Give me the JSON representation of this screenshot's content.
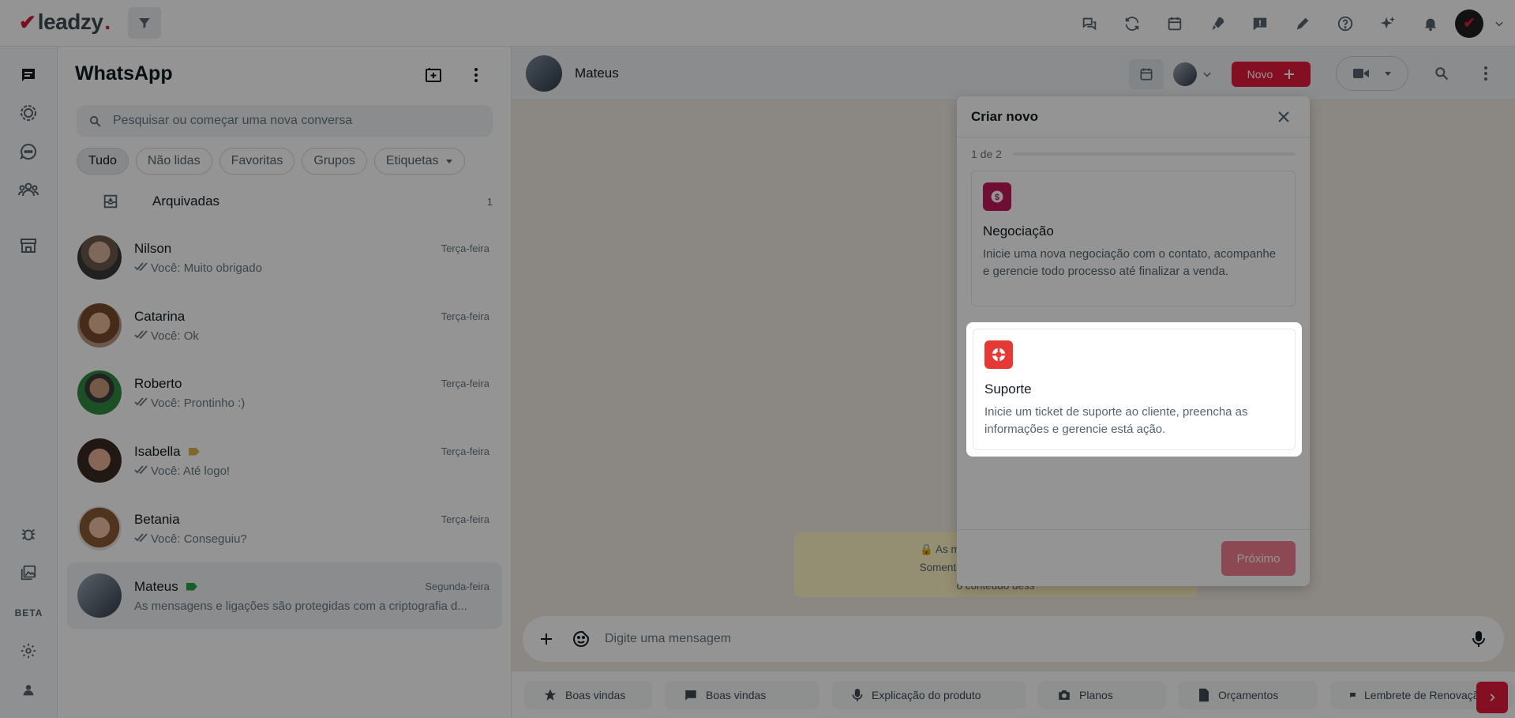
{
  "brand": {
    "name": "leadzy",
    "dot": "."
  },
  "topbar": {
    "icons": [
      "chat-bubbles-icon",
      "sync-icon",
      "calendar-icon",
      "rocket-icon",
      "message-alert-icon",
      "pen-icon",
      "help-icon",
      "sparkles-icon",
      "bell-icon"
    ]
  },
  "rail": {
    "beta_label": "BETA"
  },
  "chatlist": {
    "title": "WhatsApp",
    "search_placeholder": "Pesquisar ou começar uma nova conversa",
    "chips": [
      "Tudo",
      "Não lidas",
      "Favoritas",
      "Grupos",
      "Etiquetas"
    ],
    "archived": {
      "label": "Arquivadas",
      "count": "1"
    },
    "chats": [
      {
        "name": "Nilson",
        "date": "Terça-feira",
        "message": "Você: Muito obrigado",
        "read": true,
        "tag": ""
      },
      {
        "name": "Catarina",
        "date": "Terça-feira",
        "message": "Você: Ok",
        "read": true,
        "tag": ""
      },
      {
        "name": "Roberto",
        "date": "Terça-feira",
        "message": "Você: Prontinho :)",
        "read": true,
        "tag": ""
      },
      {
        "name": "Isabella",
        "date": "Terça-feira",
        "message": "Você: Até logo!",
        "read": true,
        "tag": "#d9b44a"
      },
      {
        "name": "Betania",
        "date": "Terça-feira",
        "message": "Você: Conseguiu?",
        "read": true,
        "tag": ""
      },
      {
        "name": "Mateus",
        "date": "Segunda-feira",
        "message": "As mensagens e ligações são protegidas com a criptografia d...",
        "read": false,
        "tag": "#25a244"
      }
    ]
  },
  "chat": {
    "contact_name": "Mateus",
    "novo_label": "Novo",
    "encryption_lines": [
      "As mensagens e ligações sã",
      "Somente as pessoas que fazem",
      "o conteúdo dess"
    ],
    "composer_placeholder": "Digite uma mensagem",
    "quick_replies": [
      "Boas vindas",
      "Boas vindas",
      "Explicação do produto",
      "Planos",
      "Orçamentos",
      "Lembrete de Renovação d"
    ]
  },
  "modal": {
    "title": "Criar novo",
    "step": "1 de 2",
    "options": [
      {
        "title": "Negociação",
        "description": "Inicie uma nova negociação com o contato, acompanhe e gerencie todo processo até finalizar a venda.",
        "color": "#c2185b"
      },
      {
        "title": "Suporte",
        "description": "Inicie um ticket de suporte ao cliente, preencha as informações e gerencie está ação.",
        "color": "#e53935"
      }
    ],
    "next_label": "Próximo"
  },
  "colors": {
    "accent": "#e3193b",
    "chat_bg": "#efeae2"
  }
}
